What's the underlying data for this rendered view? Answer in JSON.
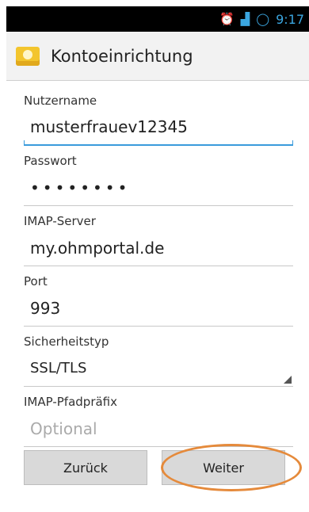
{
  "status_bar": {
    "icons": [
      "alarm-icon",
      "signal-icon",
      "sync-icon"
    ],
    "time": "9:17"
  },
  "header": {
    "title": "Kontoeinrichtung",
    "icon": "email-icon"
  },
  "form": {
    "username_label": "Nutzername",
    "username_value": "musterfrauev12345",
    "password_label": "Passwort",
    "password_value": "••••••••",
    "server_label": "IMAP-Server",
    "server_value": "my.ohmportal.de",
    "port_label": "Port",
    "port_value": "993",
    "security_label": "Sicherheitstyp",
    "security_value": "SSL/TLS",
    "prefix_label": "IMAP-Pfadpräfix",
    "prefix_placeholder": "Optional"
  },
  "buttons": {
    "back_label": "Zurück",
    "next_label": "Weiter"
  },
  "colors": {
    "accent": "#3a9bdc",
    "highlight": "#e58a3b",
    "status_icon": "#3ba6e0"
  }
}
